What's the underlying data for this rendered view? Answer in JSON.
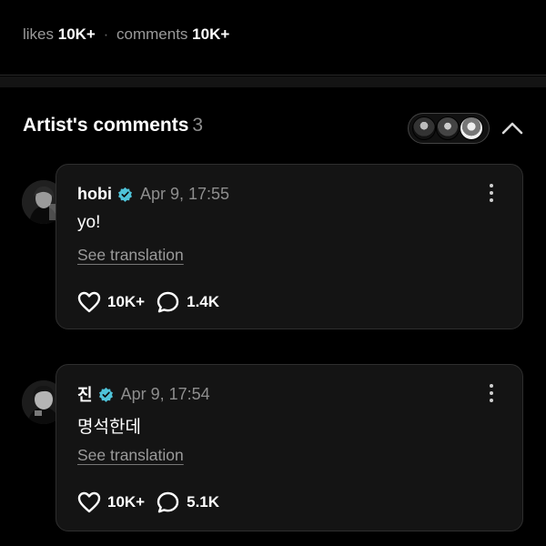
{
  "stats": {
    "likes_label": "likes",
    "likes_value": "10K+",
    "separator": "·",
    "comments_label": "comments",
    "comments_value": "10K+"
  },
  "section": {
    "title": "Artist's comments",
    "count": "3"
  },
  "colors": {
    "background": "#000000",
    "card": "#141414",
    "verified_badge": "#4fc3d9",
    "muted_text": "#8e8e8e"
  },
  "comments": [
    {
      "author": "hobi",
      "timestamp": "Apr 9, 17:55",
      "text": "yo!",
      "translation_link": "See translation",
      "likes": "10K+",
      "replies": "1.4K"
    },
    {
      "author": "진",
      "timestamp": "Apr 9, 17:54",
      "text": "명석한데",
      "translation_link": "See translation",
      "likes": "10K+",
      "replies": "5.1K"
    }
  ]
}
